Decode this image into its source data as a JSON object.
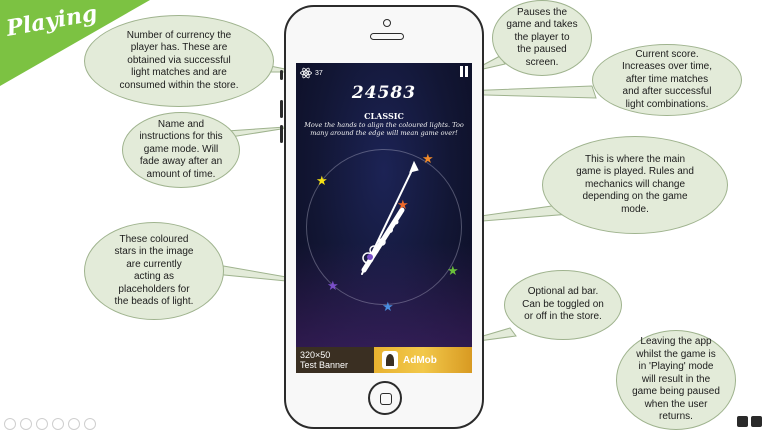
{
  "section_title": "Playing",
  "annotations": {
    "currency": [
      "Number of currency the",
      "player has. These are",
      "obtained via successful",
      "light matches and are",
      "consumed within the store."
    ],
    "pause": [
      "Pauses the",
      "game and takes",
      "the player to",
      "the paused",
      "screen."
    ],
    "score": [
      "Current score.",
      "Increases over time,",
      "after time matches",
      "and after successful",
      "light combinations."
    ],
    "mode": [
      "Name and",
      "instructions for this",
      "game mode. Will",
      "fade away after an",
      "amount of time."
    ],
    "main": [
      "This is where the main",
      "game is played. Rules and",
      "mechanics will change",
      "depending on the game",
      "mode."
    ],
    "stars": [
      "These coloured",
      "stars in the image",
      "are currently",
      "acting as",
      "placeholders for",
      "the beads of light."
    ],
    "ad": [
      "Optional ad bar.",
      "Can be toggled on",
      "or off in the store."
    ],
    "leaving": [
      "Leaving the app",
      "whilst the game is",
      "in 'Playing' mode",
      "will result in the",
      "game being paused",
      "when the user",
      "returns."
    ]
  },
  "game": {
    "currency_count": "37",
    "score": "24583",
    "mode_name": "CLASSIC",
    "instructions": "Move the hands to align the coloured lights. Too many around the edge will mean game over!",
    "stars": [
      {
        "color": "#f08a2a"
      },
      {
        "color": "#f5e015"
      },
      {
        "color": "#f06a2a"
      },
      {
        "color": "#6abf3a"
      },
      {
        "color": "#7a4fc8"
      },
      {
        "color": "#4a8ee0"
      }
    ]
  },
  "ad_bar": {
    "size_label": "320×50",
    "test_label": "Test Banner",
    "brand": "AdMob"
  },
  "colors": {
    "accent": "#7cc242",
    "bubble_fill": "#e3ebd9"
  }
}
